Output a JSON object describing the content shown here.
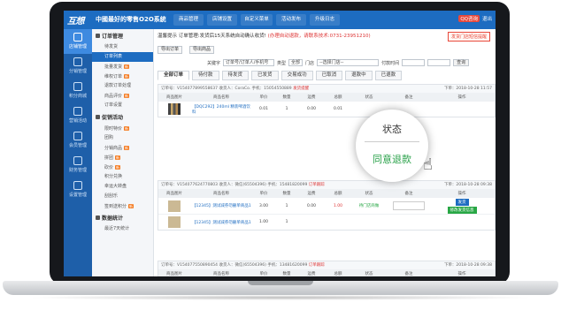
{
  "header": {
    "logo": "互想",
    "system_title": "中國最好的零售O2O系統",
    "nav_tabs": [
      "商品管理",
      "店铺设置",
      "自定义菜单",
      "活动发布",
      "升级日志"
    ],
    "user_badge": "QQ咨询",
    "user_name": "退出"
  },
  "leftnav": {
    "items": [
      "店铺管理",
      "分销管理",
      "积分商城",
      "营销活动",
      "会员管理",
      "财务管理",
      "设置管理"
    ]
  },
  "submenu": {
    "section1": "订单管理",
    "items1": [
      {
        "label": "待发货",
        "badge": ""
      },
      {
        "label": "订单列表",
        "badge": ""
      },
      {
        "label": "批量发货",
        "badge": "新"
      },
      {
        "label": "维权订单",
        "badge": "新"
      },
      {
        "label": "退款订单处理",
        "badge": ""
      },
      {
        "label": "商品评价",
        "badge": "新"
      },
      {
        "label": "订单设置",
        "badge": ""
      }
    ],
    "section2": "促销活动",
    "items2": [
      {
        "label": "限时特价",
        "badge": "新"
      },
      {
        "label": "团购",
        "badge": ""
      },
      {
        "label": "分销商品",
        "badge": "新"
      },
      {
        "label": "拼团",
        "badge": "新"
      },
      {
        "label": "砍价",
        "badge": "新"
      },
      {
        "label": "积分兑换",
        "badge": ""
      },
      {
        "label": "幸运大转盘",
        "badge": ""
      },
      {
        "label": "刮刮乐",
        "badge": ""
      },
      {
        "label": "签到送积分",
        "badge": "新"
      }
    ],
    "section3": "数据统计",
    "items3": [
      {
        "label": "最近7天统计",
        "badge": ""
      }
    ]
  },
  "main": {
    "notice_label": "温馨提示",
    "notice_text": "订单管理:发货后15天系统自动确认收货!",
    "notice_red": "(办理自动退款，请联系技术:0731-23951210)",
    "remind_button": "发货门店短信提醒",
    "toolbar": {
      "export_orders": "导出订单",
      "export_goods": "导出商品"
    },
    "filter": {
      "keyword_label": "关键字",
      "keyword_placeholder": "订单号/订单人/手机号",
      "type_label": "类型",
      "type_value": "全部",
      "store_label": "门店",
      "store_value": "--选择门店--",
      "time_label": "付款时间",
      "search_button": "查询"
    },
    "tabs": [
      "全部订单",
      "待付款",
      "待发货",
      "已发货",
      "交易成功",
      "已取消",
      "退款中",
      "已退款"
    ],
    "columns": [
      "商品图片",
      "商品名称",
      "单价",
      "数量",
      "运费",
      "总额",
      "状态",
      "备注",
      "操作"
    ]
  },
  "orders": [
    {
      "order_no": "订单号：V154077899558637",
      "buyer": "收货人：CoraCo.",
      "phone": "手机：15054550889",
      "flag": "发货提醒",
      "time": "下单：2018-10-28 11:57",
      "items": [
        {
          "name": "【DQC292】240ml 精装啤酒饮料",
          "price": "0.01",
          "qty": "1",
          "freight": "0.00",
          "total": "0.01",
          "status": "",
          "note": "",
          "actions": []
        }
      ]
    },
    {
      "order_no": "订单号：V154077624770803",
      "buyer": "收货人：微信(65504396)",
      "phone": "手机：15481820099",
      "flag": "订单跟踪",
      "time": "下单：2018-10-28 09:38",
      "items": [
        {
          "name": "【12345】测试减券勿删单商品1",
          "price": "3.00",
          "qty": "1",
          "freight": "0.00",
          "total": "1.00",
          "status": "待门店商做",
          "note": "",
          "actions": [
            "发货",
            "修改发货信息"
          ]
        },
        {
          "name": "【12345】测试减券勿删单商品1",
          "price": "1.00",
          "qty": "1",
          "freight": "",
          "total": "",
          "status": "",
          "note": "",
          "actions": []
        }
      ]
    },
    {
      "order_no": "订单号：V154077550890454",
      "buyer": "收货人：微信(65504396)",
      "phone": "手机：13481620099",
      "flag": "订单跟踪",
      "time": "下单：2018-10-28 09:38",
      "items": []
    }
  ],
  "popup": {
    "title": "状态",
    "value": "同意退款"
  },
  "colors": {
    "topbar": "#1d6cc1",
    "leftnav": "#1e5fa9",
    "accent_green": "#2aa24a"
  }
}
